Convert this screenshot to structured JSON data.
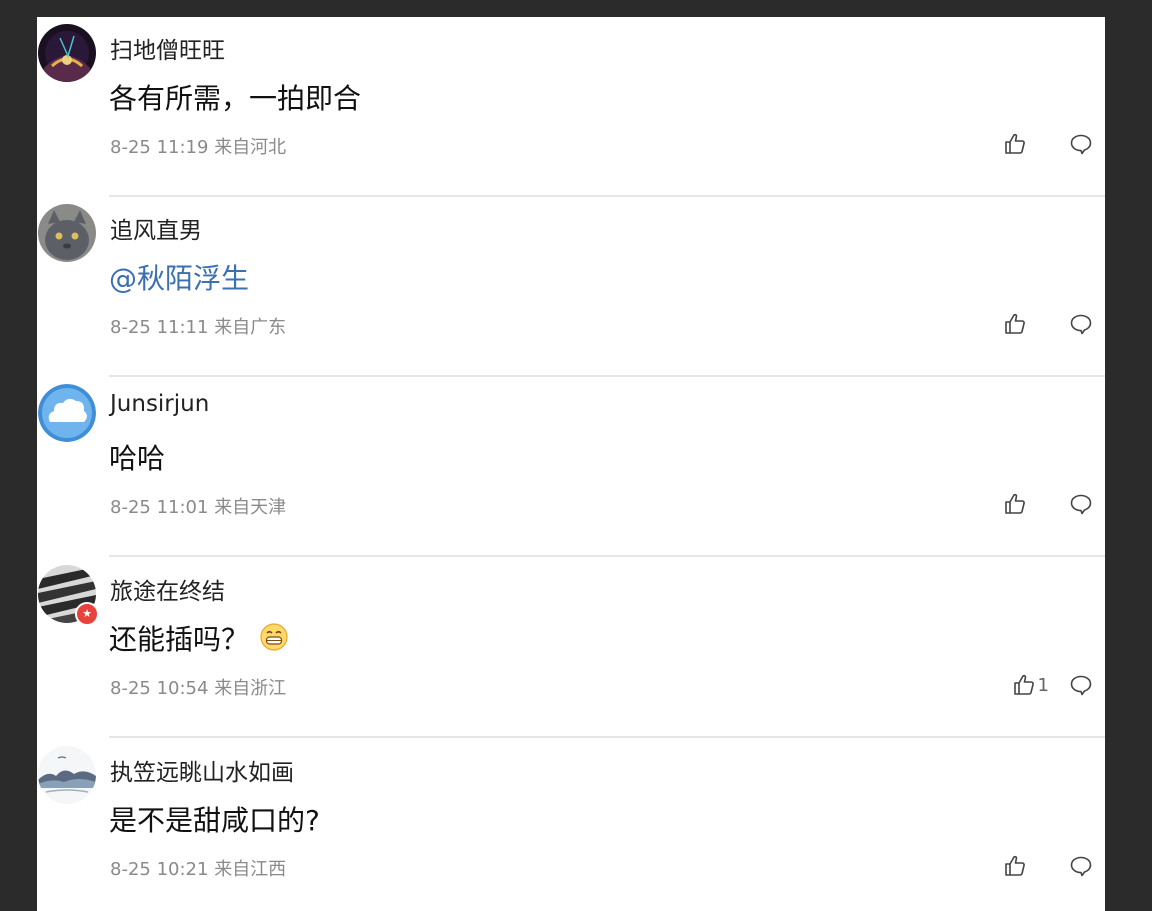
{
  "comments": [
    {
      "username": "扫地僧旺旺",
      "text": "各有所需，一拍即合",
      "time": "8-25 11:19",
      "location": "来自河北",
      "likes": "",
      "avatar": "dark-cosmic-avatar"
    },
    {
      "username": "追风直男",
      "text": "@秋陌浮生",
      "time": "8-25 11:11",
      "location": "来自广东",
      "likes": "",
      "avatar": "grey-cat-avatar"
    },
    {
      "username": "Junsirjun",
      "text": "哈哈",
      "time": "8-25 11:01",
      "location": "来自天津",
      "likes": "",
      "avatar": "blue-cloud-avatar"
    },
    {
      "username": "旅途在终结",
      "text": "还能插吗？",
      "time": "8-25 10:54",
      "location": "来自浙江",
      "likes": "1",
      "avatar": "car-grille-avatar"
    },
    {
      "username": "执笠远眺山水如画",
      "text": "是不是甜咸口的?",
      "time": "8-25 10:21",
      "location": "来自江西",
      "likes": "",
      "avatar": "ink-landscape-avatar"
    }
  ],
  "colors": {
    "background": "#2b2b2b",
    "panel": "#ffffff",
    "mention": "#3a6fb0",
    "meta": "#8a8a8a"
  }
}
